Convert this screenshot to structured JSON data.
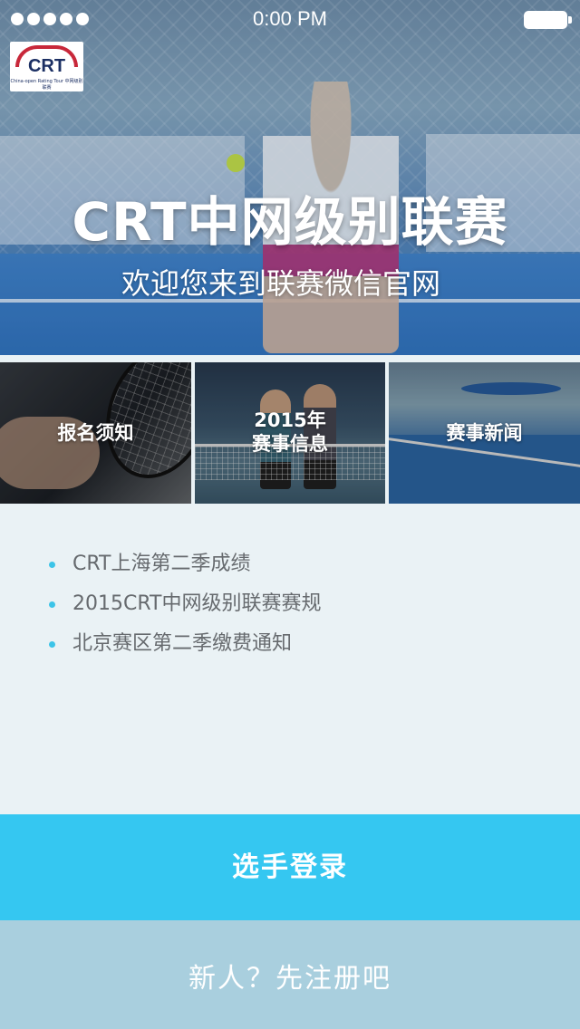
{
  "status_bar": {
    "time": "0:00 PM",
    "signal_dots": 5,
    "battery_icon": "battery-icon"
  },
  "logo": {
    "text": "CRT",
    "subtitle": "China-open Rating Tour 中网级别联赛"
  },
  "hero": {
    "title": "CRT中网级别联赛",
    "subtitle": "欢迎您来到联赛微信官网"
  },
  "tiles": [
    {
      "line1": "报名须知",
      "line2": ""
    },
    {
      "line1": "2015年",
      "line2": "赛事信息"
    },
    {
      "line1": "赛事新闻",
      "line2": ""
    }
  ],
  "news": [
    "CRT上海第二季成绩",
    "2015CRT中网级别联赛赛规",
    "北京赛区第二季缴费通知"
  ],
  "buttons": {
    "login": "选手登录",
    "register": "新人？先注册吧"
  },
  "colors": {
    "accent": "#35c7f1",
    "register_bg": "#a9cfde",
    "page_bg": "#eaf2f5",
    "bullet": "#3cc4e8",
    "logo_red": "#c8283a",
    "logo_navy": "#1b2f63"
  }
}
